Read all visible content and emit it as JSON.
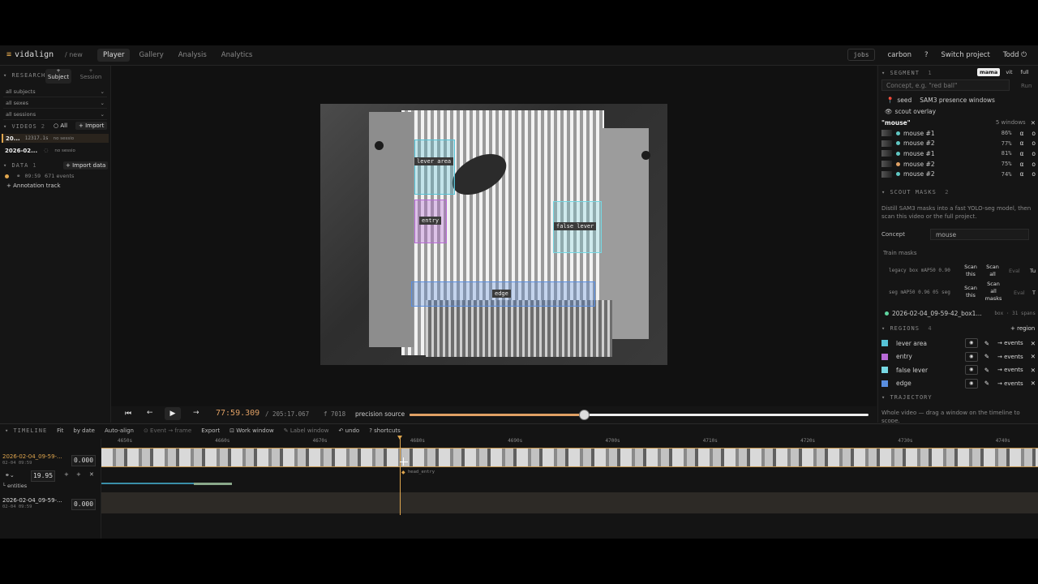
{
  "app": {
    "logo": "vidalign",
    "slug": "/ new"
  },
  "nav": {
    "tabs": [
      "Player",
      "Gallery",
      "Analysis",
      "Analytics"
    ]
  },
  "topright": {
    "jobs": "jobs",
    "carbon": "carbon",
    "help": "?",
    "switch": "Switch project",
    "user": "Todd"
  },
  "research": {
    "title": "RESEARCH",
    "subject_tab": "Subject",
    "session_tab": "Session",
    "filters": [
      "all subjects",
      "all sexes",
      "all sessions"
    ]
  },
  "videos": {
    "title": "VIDEOS",
    "count": "2",
    "all_label": "All",
    "import_label": "+ Import",
    "items": [
      {
        "name": "20...",
        "meta": "12317.1s",
        "status": "no sessio"
      },
      {
        "name": "2026-02...",
        "meta": "",
        "status": "no sessio"
      }
    ]
  },
  "data": {
    "title": "DATA",
    "count": "1",
    "import_label": "+ Import data",
    "item_time": "09:59",
    "item_events": "671 events",
    "annotation": "+ Annotation track"
  },
  "roi_labels": {
    "lever_area": "lever area",
    "entry": "entry",
    "false_lever": "false lever",
    "edge": "edge"
  },
  "player": {
    "time": "77:59.309",
    "duration": "/ 205:17.067",
    "frame": "f 7018",
    "source": "precision source",
    "progress": 0.38
  },
  "segment": {
    "title": "SEGMENT",
    "count": "1",
    "modes": [
      "mama",
      "vit",
      "full"
    ],
    "placeholder": "Concept, e.g. \"red ball\"",
    "run": "Run",
    "seed": "seed",
    "presence": "SAM3 presence windows",
    "scout_overlay": "scout overlay",
    "concept_label": "\"mouse\"",
    "windows": "5 windows",
    "results": [
      {
        "name": "mouse #1",
        "pct": "86%",
        "color": "#5fc6c2"
      },
      {
        "name": "mouse #2",
        "pct": "77%",
        "color": "#5fc6c2"
      },
      {
        "name": "mouse #1",
        "pct": "81%",
        "color": "#5fc6c2"
      },
      {
        "name": "mouse #2",
        "pct": "75%",
        "color": "#e0a064"
      },
      {
        "name": "mouse #2",
        "pct": "74%",
        "color": "#5fc6c2"
      }
    ],
    "alpha": "α",
    "vis": "o"
  },
  "scout": {
    "title": "SCOUT MASKS",
    "count": "2",
    "desc": "Distill SAM3 masks into a fast YOLO-seg model, then scan this video or the full project.",
    "concept_label": "Concept",
    "concept_value": "mouse",
    "train": "Train masks",
    "rows": [
      {
        "label": "legacy box mAP50 0.90",
        "scan_this": "Scan this",
        "scan_all": "Scan all",
        "eval": "Eval",
        "tune": "Tu"
      },
      {
        "label": "seg mAP50 0.96 05 seg",
        "scan_this": "Scan this",
        "scan_all": "Scan all masks",
        "eval": "Eval",
        "tune": "T"
      }
    ],
    "file": "2026-02-04_09-59-42_box1...",
    "file_meta": "box · 31 spans"
  },
  "regions": {
    "title": "REGIONS",
    "count": "4",
    "add": "+ region",
    "events_label": "→ events",
    "items": [
      {
        "name": "lever area",
        "color": "#56c3d6"
      },
      {
        "name": "entry",
        "color": "#b86ad6"
      },
      {
        "name": "false lever",
        "color": "#77d8e3"
      },
      {
        "name": "edge",
        "color": "#5a8ee0"
      }
    ]
  },
  "trajectory": {
    "title": "TRAJECTORY",
    "desc": "Whole video — drag a window on the timeline to scope."
  },
  "timeline": {
    "title": "TIMELINE",
    "fit": "Fit",
    "by_date": "by date",
    "auto_align": "Auto-align",
    "event_frame": "Event → frame",
    "export": "Export",
    "work_window": "Work window",
    "label_window": "Label window",
    "undo": "undo",
    "shortcuts": "? shortcuts",
    "ticks": [
      "4650s",
      "4660s",
      "4670s",
      "4680s",
      "4690s",
      "4700s",
      "4710s",
      "4720s",
      "4730s",
      "4740s"
    ],
    "track1": {
      "name": "2026-02-04_09-59-...",
      "date": "02-04 09:59",
      "offset": "0.000",
      "fps": "19.95",
      "entities": "entities"
    },
    "track2": {
      "name": "2026-02-04_09-59-...",
      "date": "02-04 09:59",
      "offset": "0.000"
    },
    "event_label": "head_entry"
  }
}
